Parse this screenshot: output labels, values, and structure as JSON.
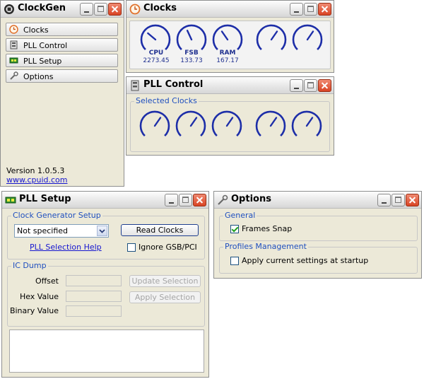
{
  "clockgen": {
    "title": "ClockGen",
    "nav": [
      "Clocks",
      "PLL Control",
      "PLL Setup",
      "Options"
    ],
    "version": "Version 1.0.5.3",
    "website": "www.cpuid.com"
  },
  "clocks": {
    "title": "Clocks",
    "gauges": [
      {
        "label": "CPU",
        "value": "2273.45"
      },
      {
        "label": "FSB",
        "value": "133.73"
      },
      {
        "label": "RAM",
        "value": "167.17"
      },
      {
        "label": "",
        "value": ""
      },
      {
        "label": "",
        "value": ""
      }
    ]
  },
  "pll_control": {
    "title": "PLL Control",
    "group_label": "Selected Clocks"
  },
  "pll_setup": {
    "title": "PLL Setup",
    "clock_group": "Clock Generator Setup",
    "clock_selected": "Not specified",
    "read_clocks": "Read Clocks",
    "pll_help": "PLL Selection Help",
    "ignore_gsb": "Ignore GSB/PCI",
    "ic_group": "IC Dump",
    "offset_label": "Offset",
    "hex_label": "Hex Value",
    "binary_label": "Binary Value",
    "update_selection": "Update Selection",
    "apply_selection": "Apply Selection"
  },
  "options": {
    "title": "Options",
    "general_group": "General",
    "frames_snap": "Frames Snap",
    "profiles_group": "Profiles Management",
    "apply_startup": "Apply current settings at startup"
  },
  "colors": {
    "gauge": "#1d2ea8",
    "legend": "#1f4fbf",
    "close": "#d94424"
  }
}
